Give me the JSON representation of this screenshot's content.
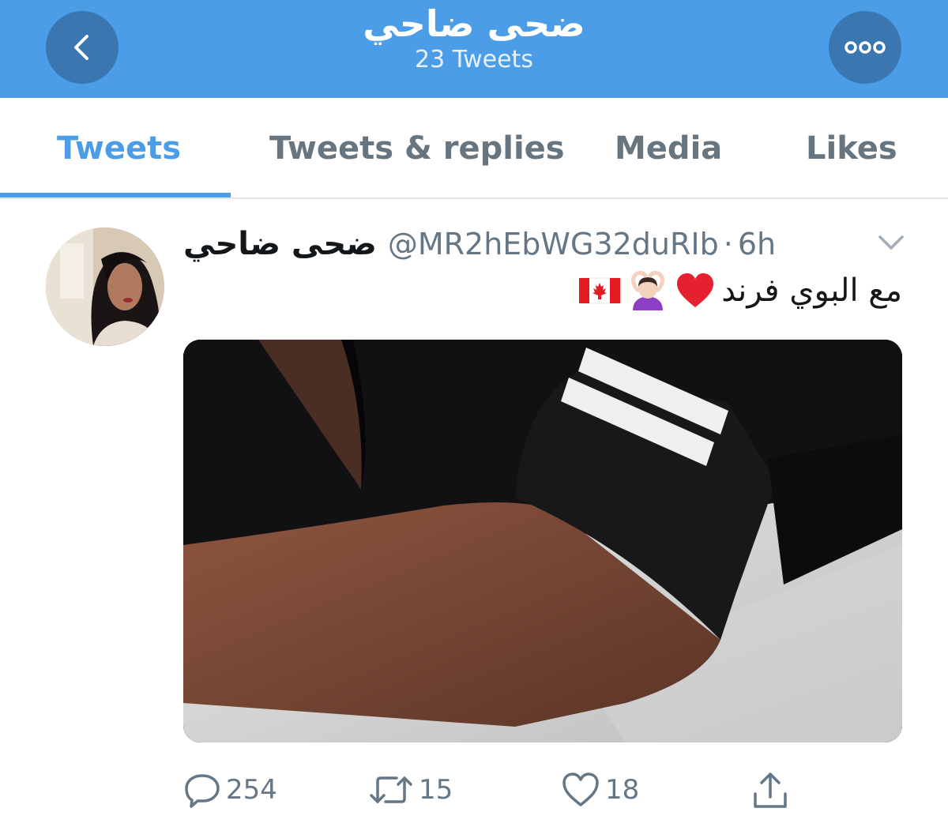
{
  "header": {
    "title": "ضحى ضاحي",
    "subtitle": "23 Tweets",
    "back_icon": "chevron-left-icon",
    "more_icon": "more-horizontal-icon",
    "color": "#4c9de7"
  },
  "tabs": [
    {
      "label": "Tweets",
      "active": true
    },
    {
      "label": "Tweets & replies",
      "active": false
    },
    {
      "label": "Media",
      "active": false
    },
    {
      "label": "Likes",
      "active": false
    }
  ],
  "tweet": {
    "display_name": "ضحى ضاحي",
    "handle": "@MR2hEbWG32duRIb",
    "separator": "·",
    "time": "6h",
    "text": "مع البوي فرند",
    "emojis": [
      "red-heart-icon",
      "person-gesturing-ok-icon",
      "canada-flag-icon"
    ],
    "actions": {
      "reply_count": "254",
      "retweet_count": "15",
      "like_count": "18"
    }
  },
  "colors": {
    "accent": "#4c9de7",
    "header_button": "#3a76af",
    "muted": "#657786",
    "text": "#14171a"
  }
}
